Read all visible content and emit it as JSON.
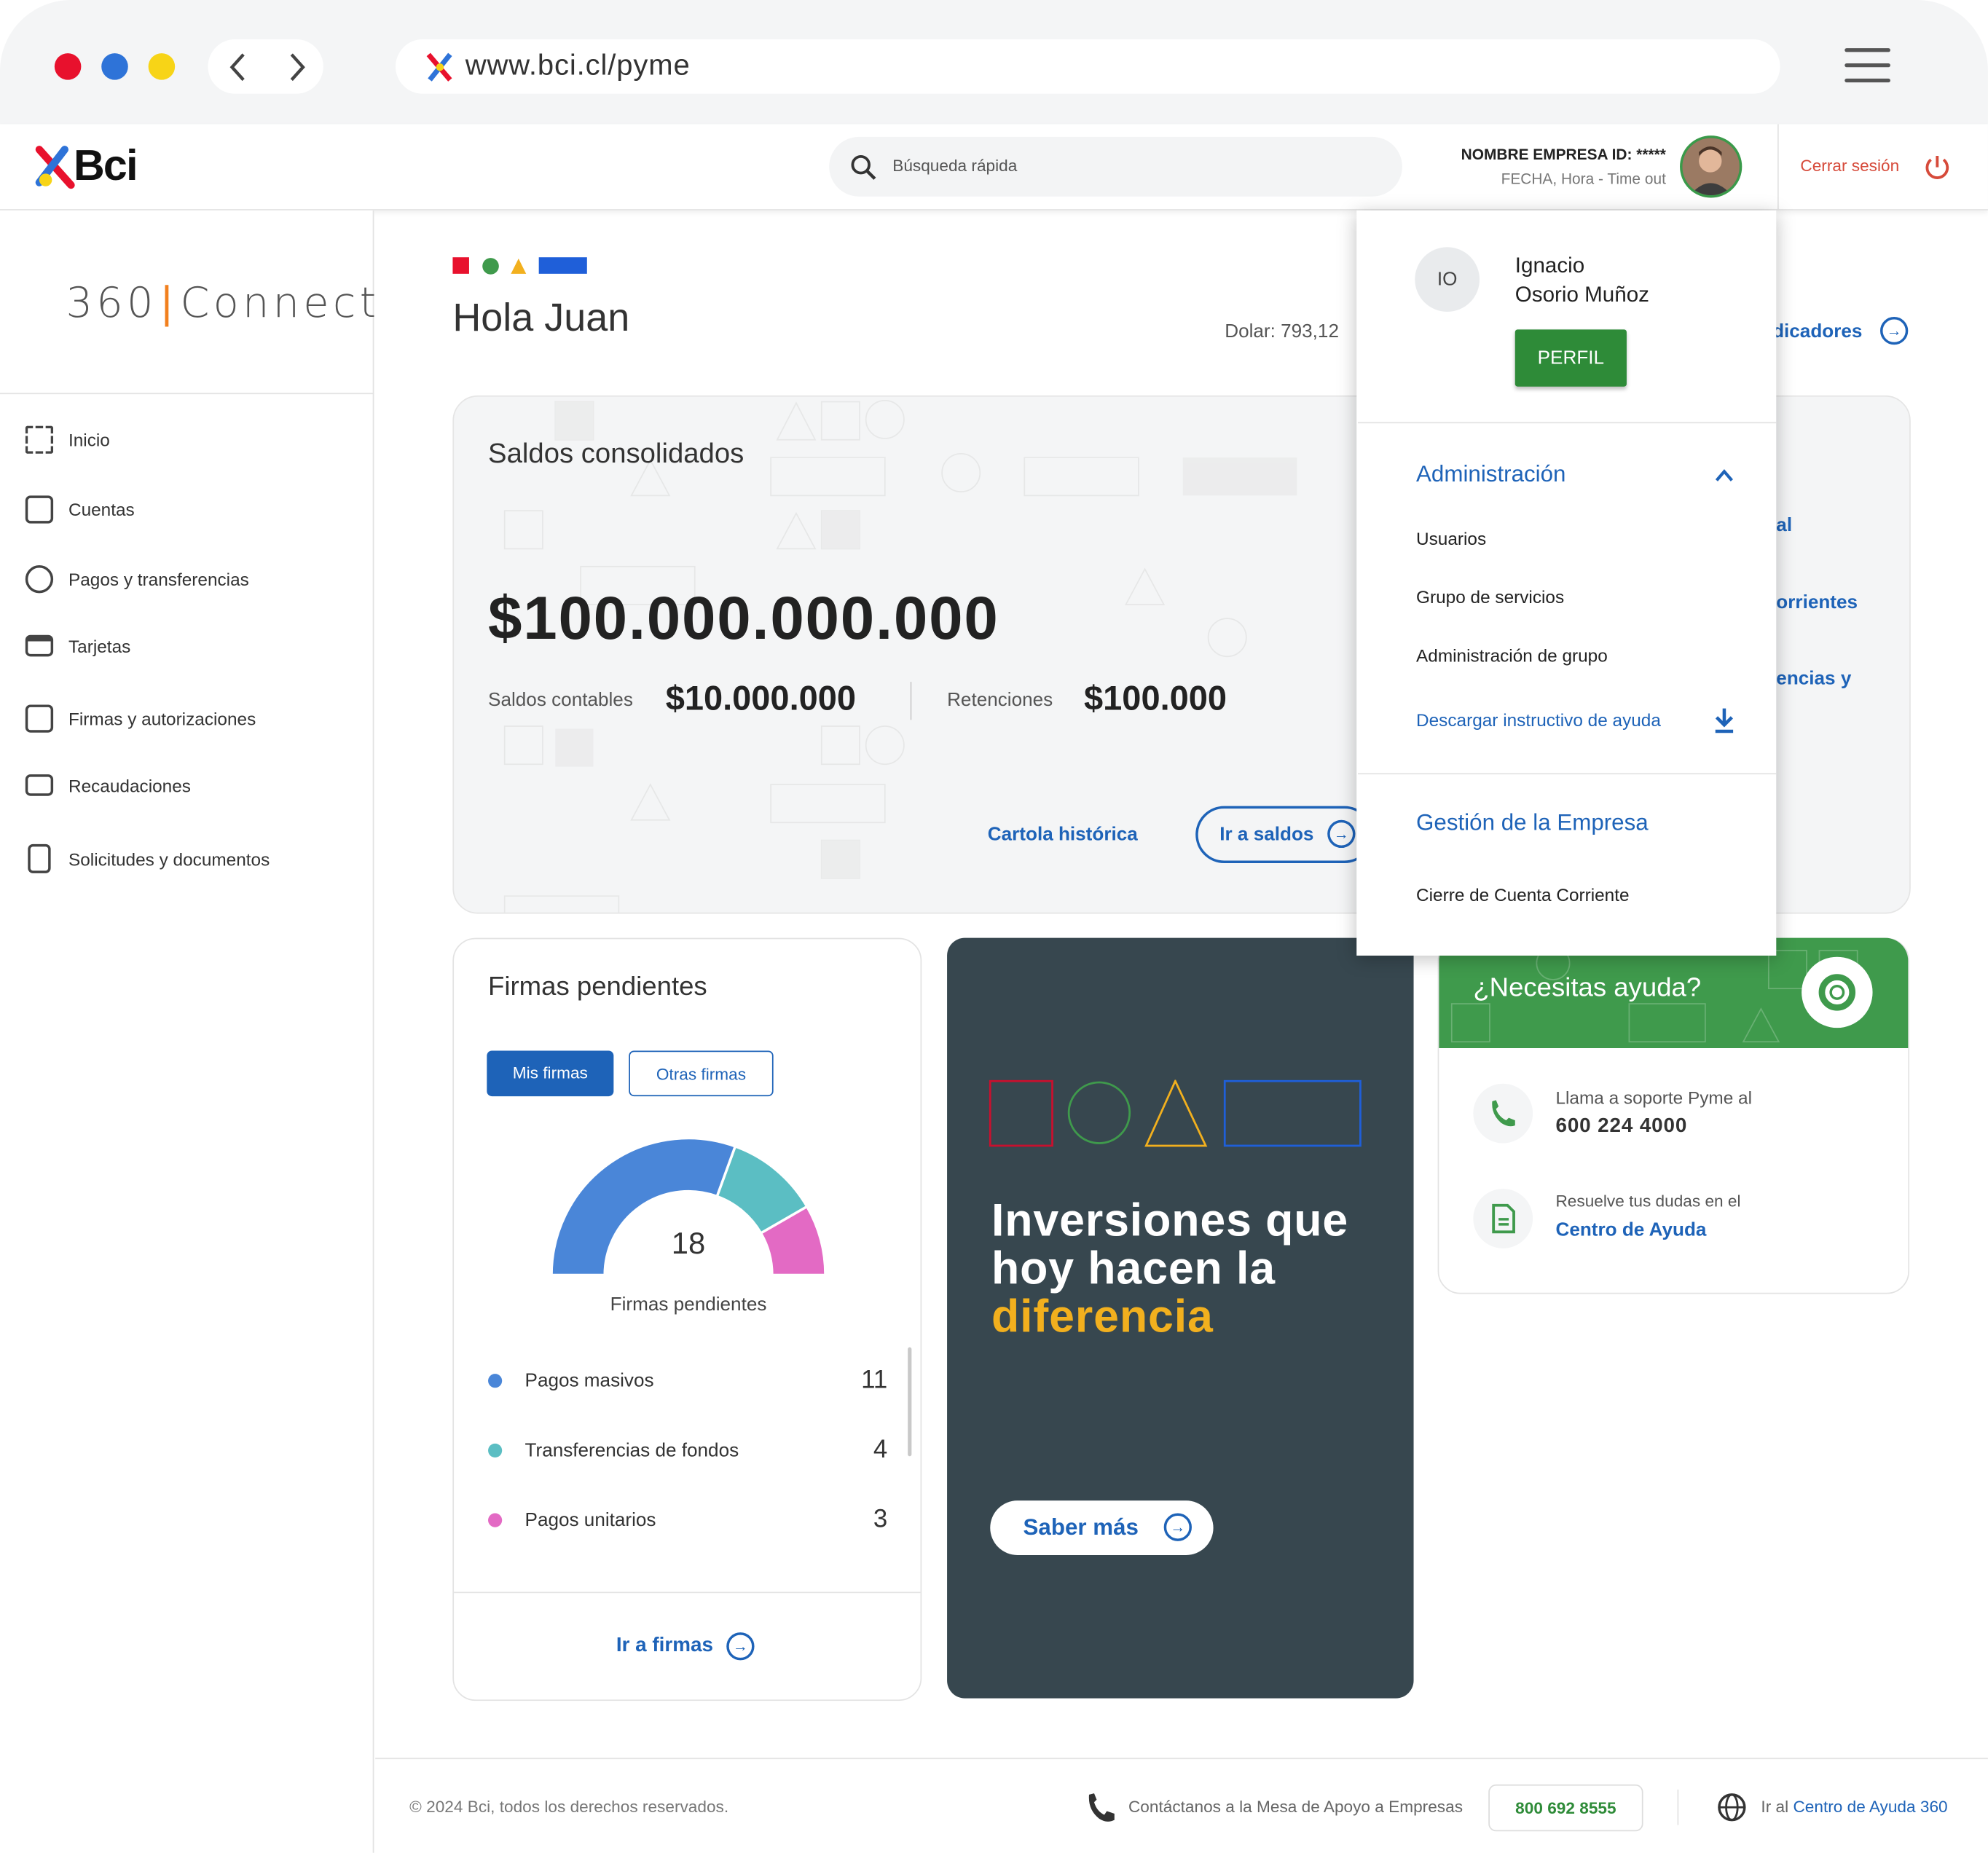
{
  "browser": {
    "url": "www.bci.cl/pyme"
  },
  "topbar": {
    "logo": "Bci",
    "search_placeholder": "Búsqueda rápida",
    "company_line": "NOMBRE EMPRESA ID: *****",
    "session_line": "FECHA, Hora - Time out",
    "logout": "Cerrar sesión"
  },
  "sidebar": {
    "brand_left": "360",
    "brand_right": "Connect",
    "items": [
      {
        "label": "Inicio",
        "icon": "grid-icon"
      },
      {
        "label": "Cuentas",
        "icon": "wallet-icon"
      },
      {
        "label": "Pagos y transferencias",
        "icon": "transfer-icon"
      },
      {
        "label": "Tarjetas",
        "icon": "card-icon"
      },
      {
        "label": "Firmas y autorizaciones",
        "icon": "signature-icon"
      },
      {
        "label": "Recaudaciones",
        "icon": "cash-icon"
      },
      {
        "label": "Solicitudes y documentos",
        "icon": "document-icon"
      }
    ]
  },
  "main": {
    "greeting": "Hola Juan",
    "dolar": "Dolar: 793,12",
    "indicadores_link": "dicadores",
    "saldos": {
      "title": "Saldos consolidados",
      "total": "$100.000.000.000",
      "contables_label": "Saldos contables",
      "contables_value": "$10.000.000",
      "retenciones_label": "Retenciones",
      "retenciones_value": "$100.000",
      "cartola": "Cartola histórica",
      "ir_saldos": "Ir a saldos"
    },
    "partial_right": {
      "a": "al",
      "b": "orrientes",
      "c": "encias y"
    }
  },
  "firmas": {
    "title": "Firmas pendientes",
    "tab_mine": "Mis firmas",
    "tab_other": "Otras firmas",
    "total": "18",
    "total_label": "Firmas pendientes",
    "items": [
      {
        "label": "Pagos masivos",
        "value": 11,
        "color": "#4a86d8"
      },
      {
        "label": "Transferencias de fondos",
        "value": 4,
        "color": "#5bbec3"
      },
      {
        "label": "Pagos unitarios",
        "value": 3,
        "color": "#e36ac4"
      }
    ],
    "link": "Ir a firmas"
  },
  "promo": {
    "line1": "Inversiones que",
    "line2": "hoy hacen la",
    "line3": "diferencia",
    "button": "Saber más"
  },
  "ayuda": {
    "title": "¿Necesitas ayuda?",
    "phone_text": "Llama a soporte Pyme al",
    "phone": "600 224 4000",
    "doc_text": "Resuelve tus dudas en el",
    "doc_link": "Centro de Ayuda"
  },
  "dropdown": {
    "initials": "IO",
    "first": "Ignacio",
    "last": "Osorio Muñoz",
    "perfil": "PERFIL",
    "admin_title": "Administración",
    "admin_items": [
      "Usuarios",
      "Grupo de servicios",
      "Administración de grupo"
    ],
    "download": "Descargar instructivo de ayuda",
    "gestion_title": "Gestión de la Empresa",
    "gestion_items": [
      "Cierre de Cuenta Corriente"
    ]
  },
  "footer": {
    "copyright": "© 2024 Bci, todos los derechos reservados.",
    "contact": "Contáctanos a la Mesa de Apoyo a Empresas",
    "phone": "800 692 8555",
    "help_prefix": "Ir al",
    "help_link": "Centro de Ayuda 360"
  },
  "colors": {
    "brand_blue": "#1e63b8",
    "green": "#3f9a4c",
    "red": "#d64a3a",
    "promo_bg": "#37474f",
    "promo_accent": "#f2b01e"
  }
}
